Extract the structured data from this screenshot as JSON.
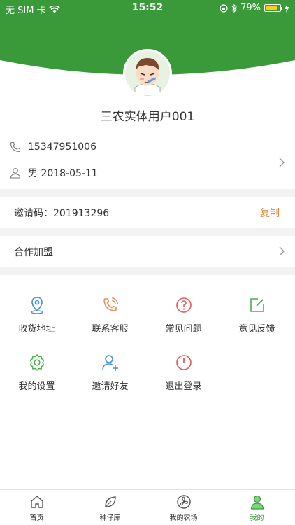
{
  "status_bar": {
    "carrier": "无 SIM 卡",
    "time": "15:52",
    "battery_pct": "79%",
    "battery_level": 0.79
  },
  "colors": {
    "brand_green": "#3a9a3a",
    "accent_orange": "#e08a3a",
    "background": "#f2f2f2"
  },
  "profile": {
    "username": "三农实体用户001",
    "phone": "15347951006",
    "gender_birth": "男 2018-05-11"
  },
  "invite": {
    "label": "邀请码：201913296",
    "copy_label": "复制"
  },
  "partner": {
    "label": "合作加盟"
  },
  "grid": {
    "items": [
      {
        "label": "收货地址",
        "icon": "location-pin-icon"
      },
      {
        "label": "联系客服",
        "icon": "phone-call-icon"
      },
      {
        "label": "常见问题",
        "icon": "question-icon"
      },
      {
        "label": "意见反馈",
        "icon": "edit-feedback-icon"
      },
      {
        "label": "我的设置",
        "icon": "gear-icon"
      },
      {
        "label": "邀请好友",
        "icon": "add-user-icon"
      },
      {
        "label": "退出登录",
        "icon": "power-icon"
      }
    ]
  },
  "tabbar": {
    "items": [
      {
        "label": "首页",
        "icon": "home-icon"
      },
      {
        "label": "种仔库",
        "icon": "leaf-icon"
      },
      {
        "label": "我的农场",
        "icon": "fan-icon"
      },
      {
        "label": "我的",
        "icon": "user-icon",
        "active": true
      }
    ]
  }
}
